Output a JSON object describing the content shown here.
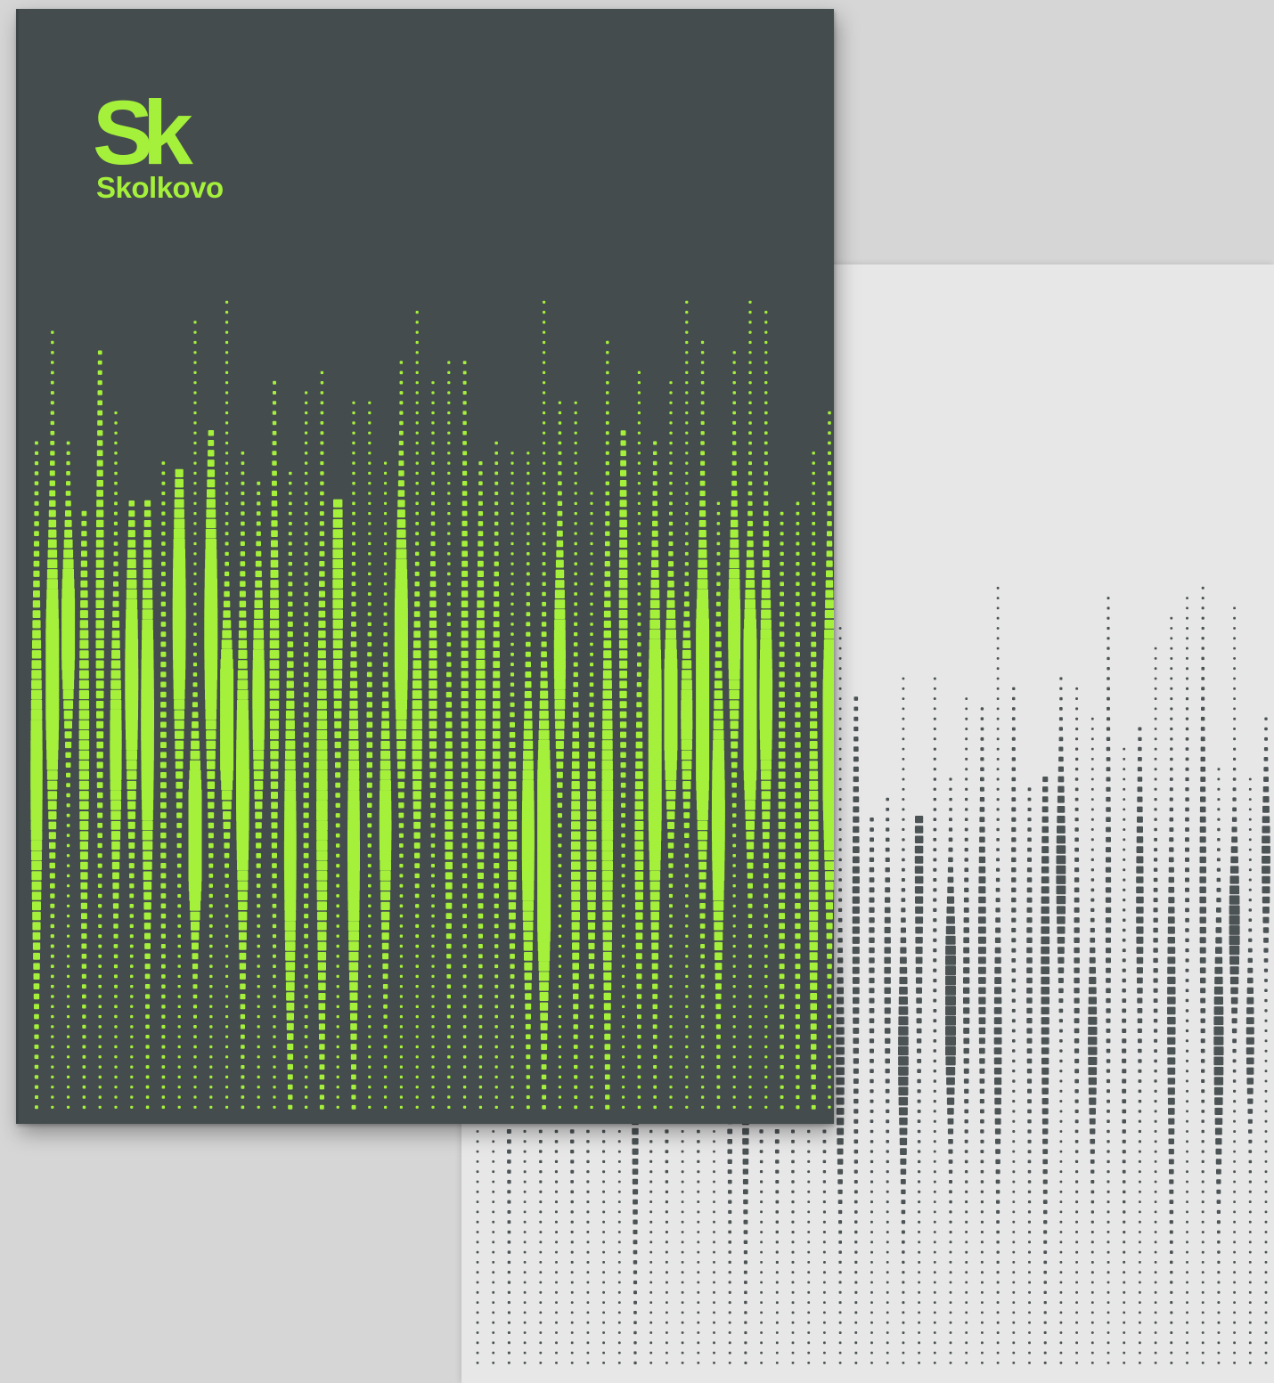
{
  "brand": {
    "mark": "Sk",
    "name": "Skolkovo"
  },
  "colors": {
    "background": "#d6d6d6",
    "folder": "#454c4e",
    "accent_green": "#a4f03a",
    "sheet": "#e7e7e7",
    "sheet_dots": "#4c5355"
  },
  "icons": {
    "logo": "sk-monogram-icon",
    "pattern": "dotted-waveform-pattern"
  }
}
